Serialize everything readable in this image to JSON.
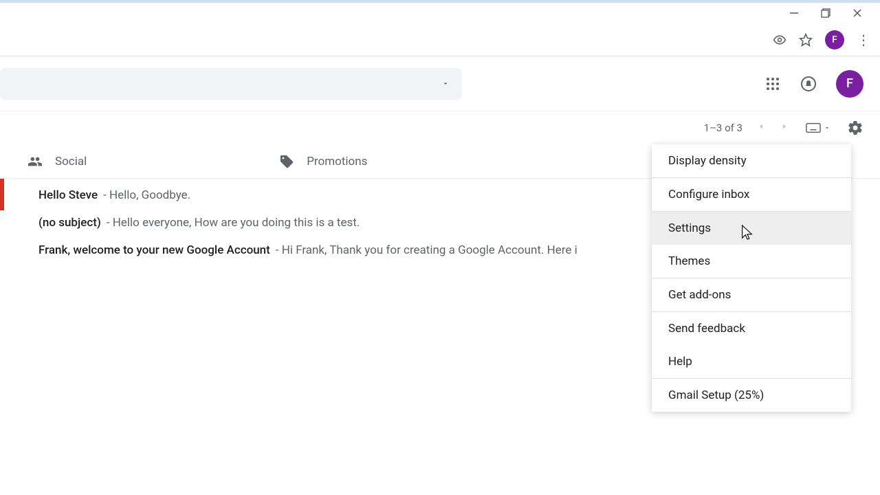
{
  "window": {
    "profile_initial": "F"
  },
  "header": {
    "avatar_initial": "F"
  },
  "toolbar": {
    "page_indicator": "1–3 of 3"
  },
  "tabs": {
    "social": "Social",
    "promotions": "Promotions"
  },
  "messages": [
    {
      "subject": "Hello Steve",
      "snippet": " - Hello, Goodbye."
    },
    {
      "subject": "(no subject)",
      "snippet": " - Hello everyone, How are you doing this is a test."
    },
    {
      "subject": "Frank, welcome to your new Google Account",
      "snippet": " - Hi Frank, Thank you for creating a Google Account. Here i"
    }
  ],
  "settings_menu": {
    "display_density": "Display density",
    "configure_inbox": "Configure inbox",
    "settings": "Settings",
    "themes": "Themes",
    "get_addons": "Get add-ons",
    "send_feedback": "Send feedback",
    "help": "Help",
    "gmail_setup": "Gmail Setup (25%)"
  }
}
